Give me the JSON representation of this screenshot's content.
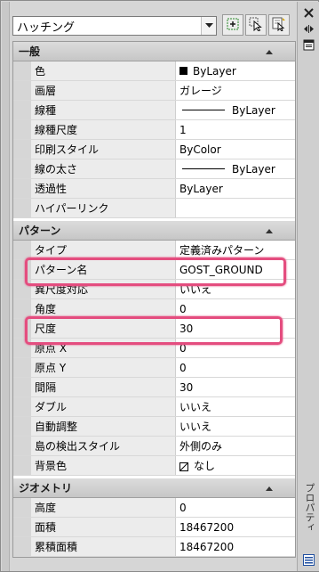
{
  "toolbar": {
    "object_type": "ハッチング",
    "buttons": [
      {
        "name": "quick-select-icon"
      },
      {
        "name": "select-objects-icon"
      },
      {
        "name": "pickadd-toggle-icon"
      }
    ]
  },
  "side": {
    "title": "プロパティ"
  },
  "sections": {
    "general": {
      "title": "一般",
      "rows": [
        {
          "label": "色",
          "value": "ByLayer",
          "swatch": "#000000"
        },
        {
          "label": "画層",
          "value": "ガレージ"
        },
        {
          "label": "線種",
          "value": "ByLayer",
          "line": true
        },
        {
          "label": "線種尺度",
          "value": "1"
        },
        {
          "label": "印刷スタイル",
          "value": "ByColor"
        },
        {
          "label": "線の太さ",
          "value": "ByLayer",
          "line": true
        },
        {
          "label": "透過性",
          "value": "ByLayer"
        },
        {
          "label": "ハイパーリンク",
          "value": ""
        }
      ]
    },
    "pattern": {
      "title": "パターン",
      "rows": [
        {
          "label": "タイプ",
          "value": "定義済みパターン"
        },
        {
          "label": "パターン名",
          "value": "GOST_GROUND"
        },
        {
          "label": "異尺度対応",
          "value": "いいえ"
        },
        {
          "label": "角度",
          "value": "0"
        },
        {
          "label": "尺度",
          "value": "30"
        },
        {
          "label": "原点 X",
          "value": "0"
        },
        {
          "label": "原点 Y",
          "value": "0"
        },
        {
          "label": "間隔",
          "value": "30"
        },
        {
          "label": "ダブル",
          "value": "いいえ"
        },
        {
          "label": "自動調整",
          "value": "いいえ"
        },
        {
          "label": "島の検出スタイル",
          "value": "外側のみ"
        },
        {
          "label": "背景色",
          "value": "なし",
          "swatch_none": true
        }
      ]
    },
    "geometry": {
      "title": "ジオメトリ",
      "rows": [
        {
          "label": "高度",
          "value": "0"
        },
        {
          "label": "面積",
          "value": "18467200"
        },
        {
          "label": "累積面積",
          "value": "18467200"
        }
      ]
    }
  },
  "colors": {
    "highlight": "#e44d7f",
    "section_bg": "#c6c6c6",
    "name_bg": "#ececec"
  }
}
